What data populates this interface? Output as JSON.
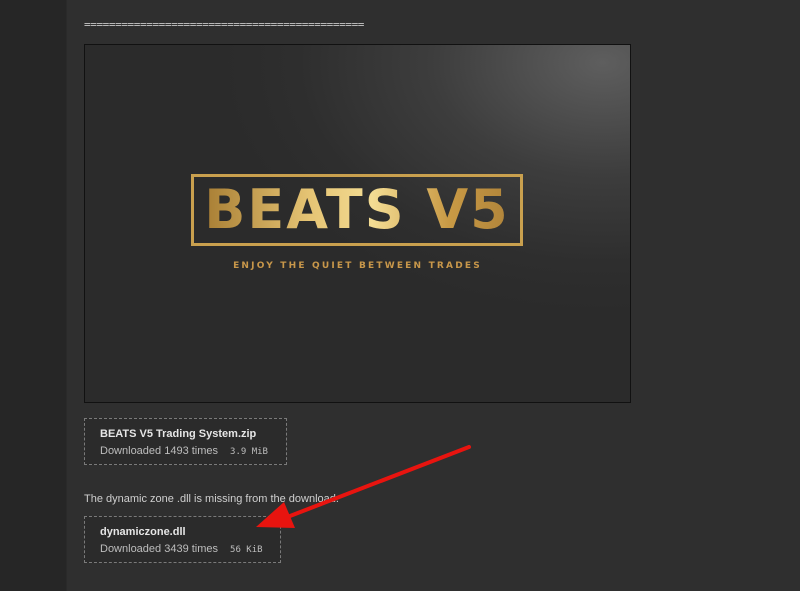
{
  "post": {
    "divider": "=============================================",
    "banner": {
      "logo_text": "BEATS V5",
      "tagline": "ENJOY THE QUIET BETWEEN TRADES"
    },
    "attachments": [
      {
        "name": "BEATS V5 Trading System.zip",
        "downloads": "Downloaded 1493 times",
        "size": "3.9 MiB"
      },
      {
        "name": "dynamiczone.dll",
        "downloads": "Downloaded 3439 times",
        "size": "56 KiB"
      }
    ],
    "note": "The dynamic zone .dll is missing from the download.",
    "annotation_color": "#e8140f",
    "gold_color": "#d2ab58"
  }
}
